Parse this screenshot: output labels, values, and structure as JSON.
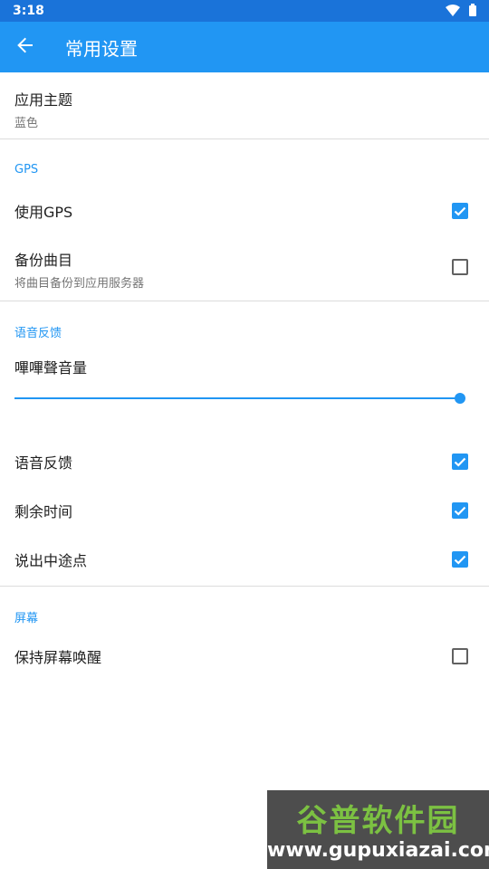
{
  "status_bar": {
    "time": "3:18",
    "icons": [
      "wifi-icon",
      "battery-icon"
    ]
  },
  "app_bar": {
    "title": "常用设置",
    "back_icon": "arrow-back-icon"
  },
  "theme": {
    "title": "应用主题",
    "value": "蓝色"
  },
  "sections": {
    "gps": {
      "header": "GPS",
      "use_gps": {
        "title": "使用GPS",
        "checked": true
      },
      "backup": {
        "title": "备份曲目",
        "subtitle": "将曲目备份到应用服务器",
        "checked": false
      }
    },
    "voice": {
      "header": "语音反馈",
      "beep_volume": {
        "title": "嗶嗶聲音量",
        "value": 1.0
      },
      "voice_feedback": {
        "title": "语音反馈",
        "checked": true
      },
      "remaining_time": {
        "title": "剩余时间",
        "checked": true
      },
      "waypoints": {
        "title": "说出中途点",
        "checked": true
      }
    },
    "screen": {
      "header": "屏幕",
      "keep_awake": {
        "title": "保持屏幕唤醒",
        "checked": false
      }
    }
  },
  "colors": {
    "primary": "#2196f3",
    "status_bar": "#1a73d9"
  },
  "watermark": {
    "brand": "谷普软件园",
    "url": "www.gupuxiazai.com"
  }
}
